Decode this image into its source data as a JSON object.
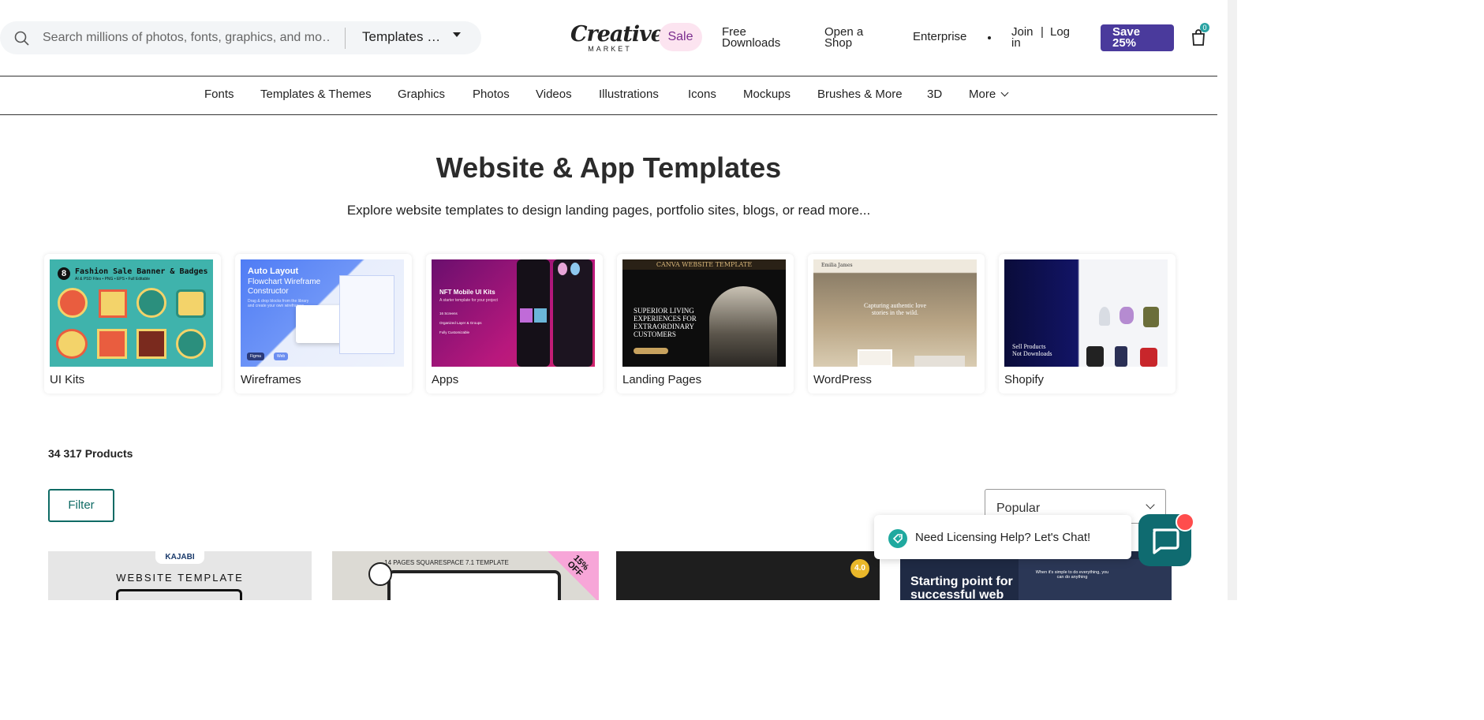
{
  "header": {
    "search_placeholder": "Search millions of photos, fonts, graphics, and mo…",
    "category_select": "Templates …",
    "logo_main": "Creative",
    "logo_sub": "MARKET",
    "sale": "Sale",
    "free_downloads_1": "Free",
    "free_downloads_2": "Downloads",
    "open_shop_1": "Open a",
    "open_shop_2": "Shop",
    "enterprise": "Enterprise",
    "join_1": "Join",
    "join_2": "in",
    "pipe": "|",
    "login": "Log",
    "save_1": "Save",
    "save_2": "25%",
    "cart_count": "0"
  },
  "nav": [
    "Fonts",
    "Templates & Themes",
    "Graphics",
    "Photos",
    "Videos",
    "Illustrations",
    "Icons",
    "Mockups",
    "Brushes & More",
    "3D",
    "More"
  ],
  "hero": {
    "title": "Website & App Templates",
    "description": "Explore website templates to design landing pages, portfolio sites, blogs, or ",
    "read_more": "read more..."
  },
  "categories": [
    {
      "label": "UI Kits",
      "thumb_text": "Fashion Sale Banner & Badges",
      "thumb_sub": "AI & PSD Files • PNG • EPS • Full Editable",
      "badge": "8"
    },
    {
      "label": "Wireframes",
      "thumb_title": "Auto Layout",
      "thumb_line2": "Flowchart Wireframe",
      "thumb_line3": "Constructor",
      "thumb_small": "Drag & drop blocks from the library and create your own wireframes",
      "tag1": "Figma",
      "tag2": "Web"
    },
    {
      "label": "Apps",
      "thumb_title": "NFT Mobile  UI Kits",
      "thumb_sub": "A starter template for your project",
      "bullet1": "16 Screens",
      "bullet2": "Organized Layer & Groups",
      "bullet3": "Fully Customizable"
    },
    {
      "label": "Landing Pages",
      "thumb_header": "CANVA WEBSITE TEMPLATE",
      "thumb_text1": "SUPERIOR LIVING",
      "thumb_text2": "EXPERIENCES FOR",
      "thumb_text3": "EXTRAORDINARY",
      "thumb_text4": "CUSTOMERS"
    },
    {
      "label": "WordPress",
      "thumb_brand": "Emilia James",
      "thumb_text1": "Capturing authentic love",
      "thumb_text2": "stories in the wild."
    },
    {
      "label": "Shopify",
      "thumb_text1": "Sell Products",
      "thumb_text2": "Not Downloads"
    }
  ],
  "listing": {
    "product_count": "34 317 Products",
    "filter": "Filter",
    "sort": "Popular"
  },
  "products": [
    {
      "badge": "KAJABI",
      "title": "WEBSITE TEMPLATE"
    },
    {
      "title": "14 PAGES SQUARESPACE 7.1 TEMPLATE",
      "ribbon_1": "15%",
      "ribbon_2": "OFF"
    },
    {
      "rating": "4.0"
    },
    {
      "headline_1": "Starting point for",
      "headline_2": "successful web",
      "small": "When it's simple to do everything, you can do anything"
    }
  ],
  "chat": {
    "text": "Need Licensing Help? Let's Chat!"
  },
  "colors": {
    "accent_teal": "#0f6b65",
    "save_purple": "#4a3a9c",
    "sale_pink": "#fce4f0"
  }
}
